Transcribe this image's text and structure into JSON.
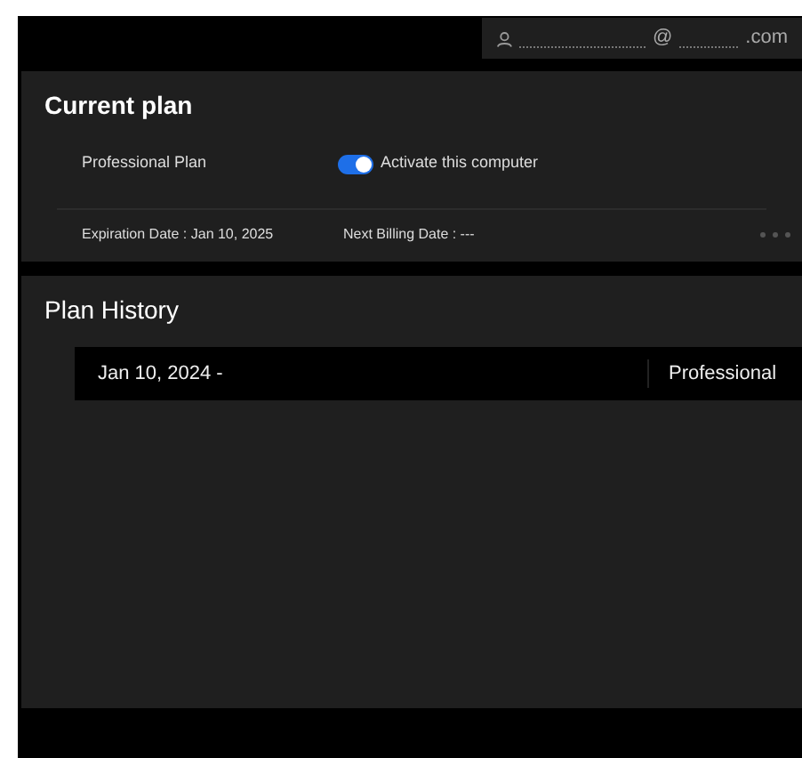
{
  "account": {
    "email_at": "@",
    "email_end": ".com"
  },
  "current_plan": {
    "title": "Current plan",
    "plan_name": "Professional Plan",
    "activate": {
      "label": "Activate this computer",
      "on": true
    },
    "expiration": "Expiration Date : Jan 10, 2025",
    "next_billing": "Next Billing Date : ---"
  },
  "plan_history": {
    "title": "Plan History",
    "rows": [
      {
        "period": "Jan 10, 2024 -",
        "plan": "Professional"
      }
    ]
  }
}
